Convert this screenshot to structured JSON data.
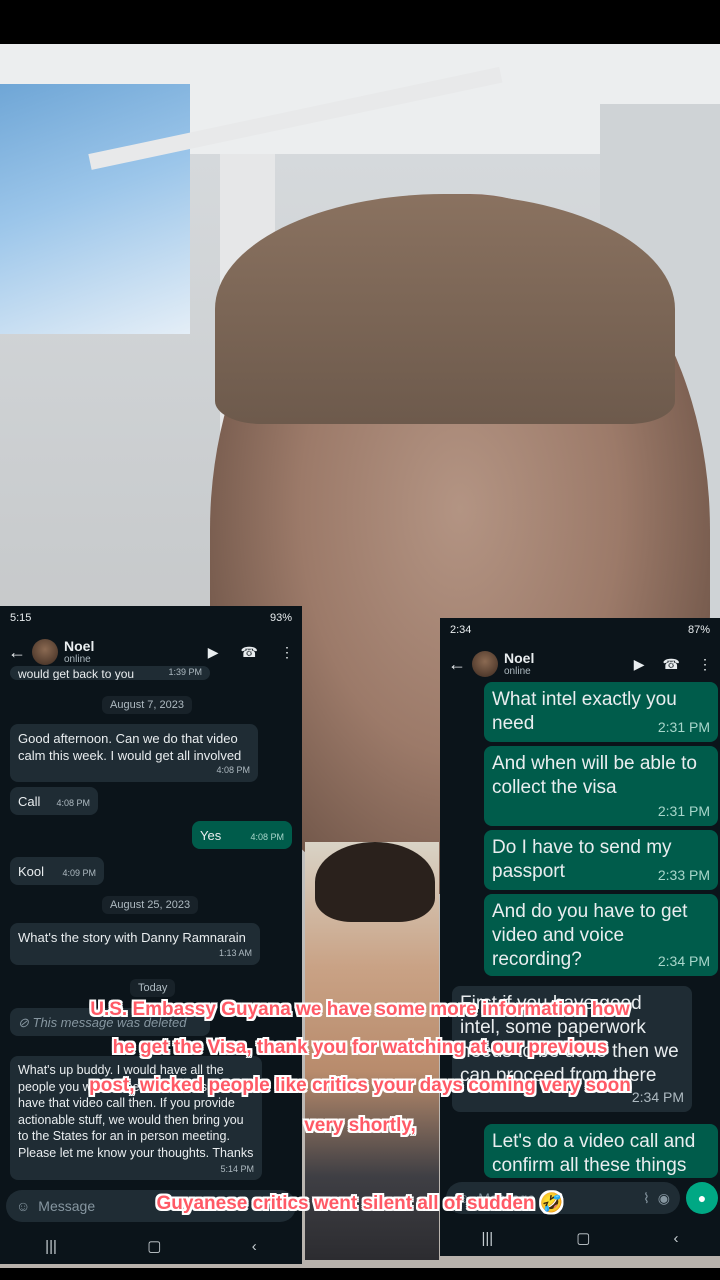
{
  "left_chat": {
    "status_time": "5:15",
    "status_right": "93%",
    "contact_name": "Noel",
    "contact_status": "online",
    "messages": [
      {
        "text": "would get back to you",
        "time": "1:39 PM"
      },
      {
        "date": "August 7, 2023"
      },
      {
        "text": "Good afternoon. Can we do that video calm this week. I would get all involved",
        "time": "4:08 PM"
      },
      {
        "text": "Call",
        "time": "4:08 PM"
      },
      {
        "text": "Yes",
        "time": "4:08 PM"
      },
      {
        "text": "Kool",
        "time": "4:09 PM"
      },
      {
        "date": "August 25, 2023"
      },
      {
        "text": "What's the story with Danny Ramnarain",
        "time": "1:13 AM"
      },
      {
        "date": "Today"
      },
      {
        "text": "This message was deleted"
      },
      {
        "text": "What's up buddy. I would have all the people you would need to talk to so we have that video call then. If you provide actionable stuff, we would then bring you to the States for an in person meeting. Please let me know your thoughts. Thanks",
        "time": "5:14 PM"
      }
    ],
    "input_placeholder": "Message"
  },
  "right_chat": {
    "status_time": "2:34",
    "status_right": "87%",
    "contact_name": "Noel",
    "contact_status": "online",
    "messages": [
      {
        "text": "What intel exactly you need",
        "time": "2:31 PM"
      },
      {
        "text": "And when will be able to collect the visa",
        "time": "2:31 PM"
      },
      {
        "text": "Do I have to send my passport",
        "time": "2:33 PM"
      },
      {
        "text": "And do you have to get video and voice recording?",
        "time": "2:34 PM"
      },
      {
        "text": "First if you have good intel, some paperwork needs to be done then we can proceed from there",
        "time": "2:34 PM"
      },
      {
        "text": "Let's do a video call and confirm all these things",
        "time": ""
      }
    ],
    "input_placeholder": "Message"
  },
  "captions": {
    "line1": "U.S. Embassy Guyana we have some more information how",
    "line2": "he get the Visa, thank you for watching at our previous",
    "line3": "post, wicked people like critics your days coming very soon",
    "line4": "very shortly,",
    "line5": "Guyanese critics went silent all of sudden 🤣"
  },
  "colors": {
    "caption": "#ff5a66",
    "outgoing_bubble": "#005c4b",
    "incoming_bubble": "#1f2c34",
    "chat_bg": "#0b141a"
  }
}
